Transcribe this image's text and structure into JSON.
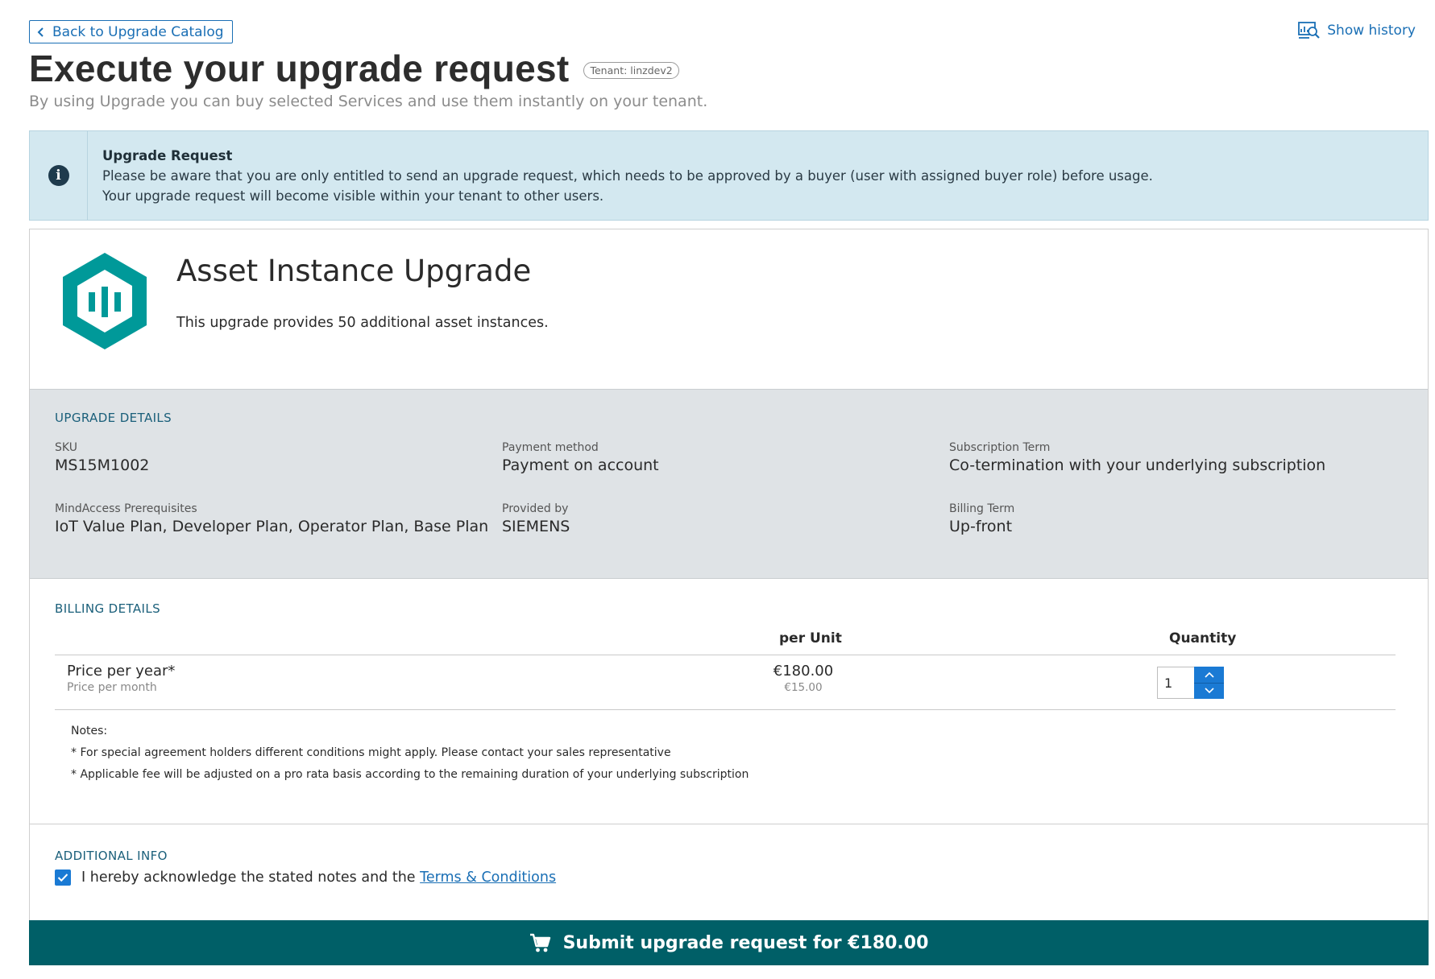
{
  "header": {
    "back_label": "Back to Upgrade Catalog",
    "history_label": "Show history",
    "title": "Execute your upgrade request",
    "tenant_badge": "Tenant: linzdev2",
    "subtitle": "By using Upgrade you can buy selected Services and use them instantly on your tenant."
  },
  "info": {
    "title": "Upgrade Request",
    "line1": "Please be aware that you are only entitled to send an upgrade request, which needs to be approved by a buyer (user with assigned buyer role) before usage.",
    "line2": "Your upgrade request will become visible within your tenant to other users."
  },
  "product": {
    "name": "Asset Instance Upgrade",
    "description": "This upgrade provides 50 additional asset instances."
  },
  "upgrade_details": {
    "heading": "UPGRADE DETAILS",
    "sku_label": "SKU",
    "sku": "MS15M1002",
    "payment_label": "Payment method",
    "payment": "Payment on account",
    "term_label": "Subscription Term",
    "term": "Co-termination with your underlying subscription",
    "prereq_label": "MindAccess Prerequisites",
    "prereq": "IoT Value Plan, Developer Plan, Operator Plan, Base Plan",
    "provider_label": "Provided by",
    "provider": "SIEMENS",
    "billing_term_label": "Billing Term",
    "billing_term": "Up-front"
  },
  "billing": {
    "heading": "BILLING DETAILS",
    "col_per_unit": "per Unit",
    "col_quantity": "Quantity",
    "row_label": "Price per year*",
    "row_sublabel": "Price per month",
    "price_year": "€180.00",
    "price_month": "€15.00",
    "quantity": "1",
    "notes_title": "Notes:",
    "note1": "* For special agreement holders different conditions might apply. Please contact your sales representative",
    "note2": "* Applicable fee will be adjusted on a pro rata basis according to the remaining duration of your underlying subscription"
  },
  "additional": {
    "heading": "ADDITIONAL INFO",
    "ack_text": "I hereby acknowledge the stated notes and the",
    "terms_link": "Terms & Conditions",
    "checked": true
  },
  "submit": {
    "label": "Submit upgrade request for €180.00"
  },
  "colors": {
    "accent": "#1a7ad4",
    "brand_teal": "#009999",
    "submit_bg": "#005f67",
    "info_bg": "#d3e8f0",
    "details_bg": "#dfe3e6"
  },
  "icons": [
    "chevron-left-icon",
    "history-icon",
    "info-icon",
    "product-hexagon-logo",
    "chevron-up-icon",
    "chevron-down-icon",
    "check-icon",
    "cart-icon"
  ]
}
